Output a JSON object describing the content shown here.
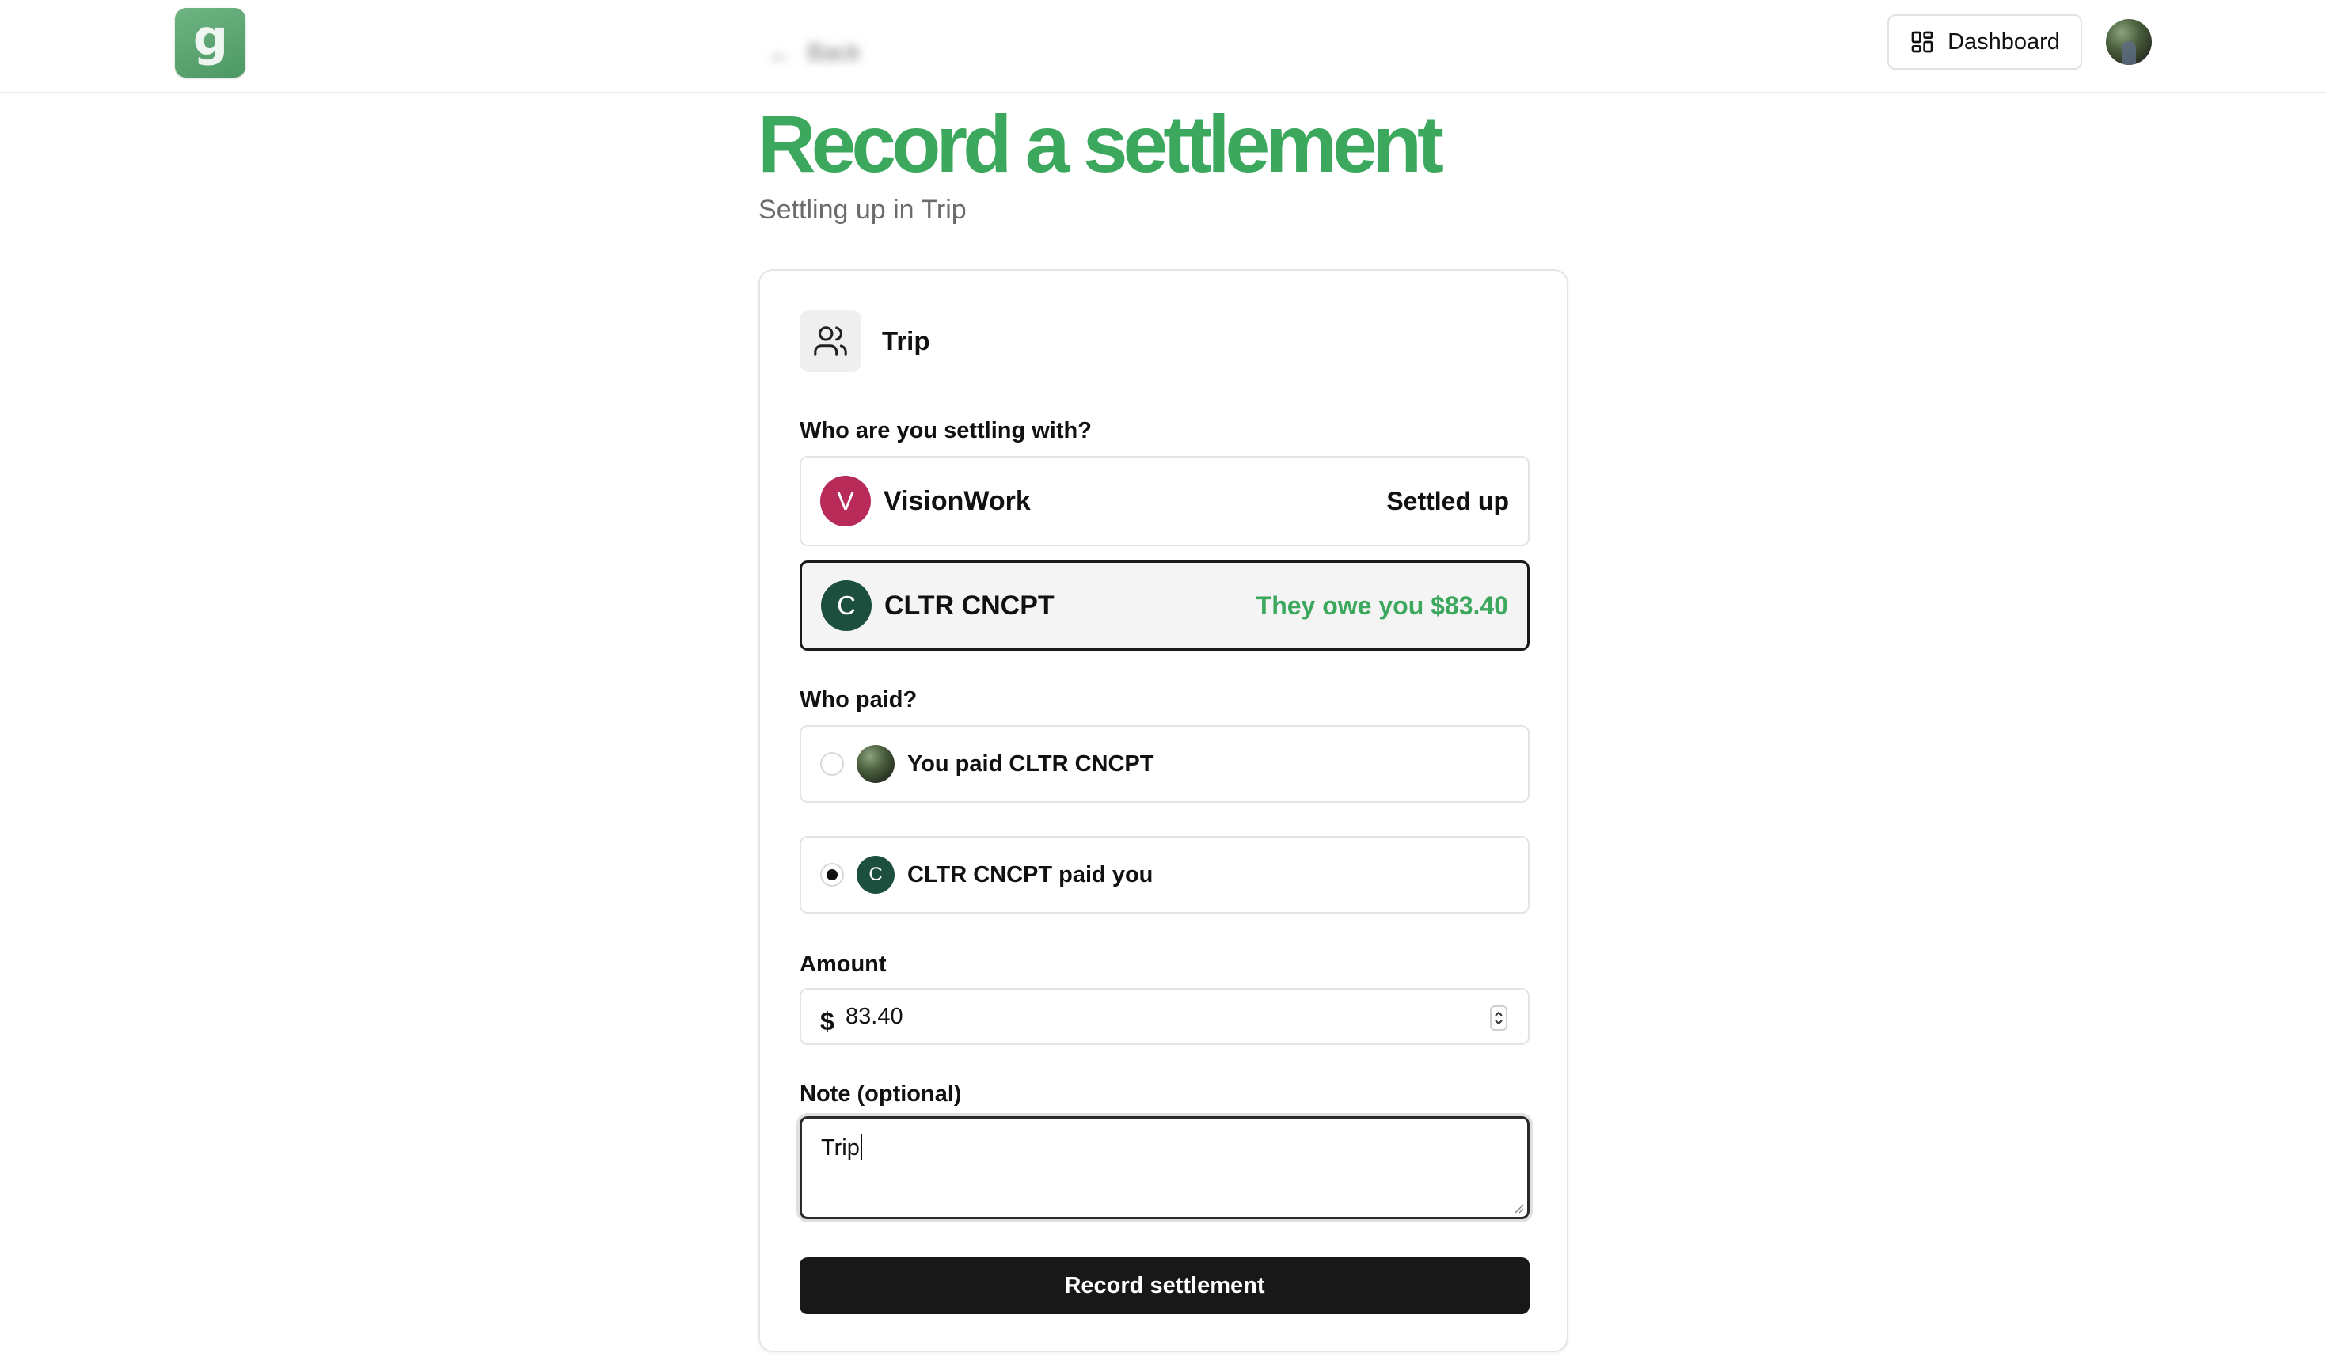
{
  "header": {
    "logo_letter": "g",
    "back_label": "Back",
    "dashboard_label": "Dashboard",
    "brand_color": "#3ba85d"
  },
  "page": {
    "title": "Record a settlement",
    "subtitle": "Settling up in Trip"
  },
  "group": {
    "name": "Trip",
    "icon": "users-icon"
  },
  "settle_with": {
    "label": "Who are you settling with?",
    "people": [
      {
        "initial": "V",
        "name": "VisionWork",
        "status": "Settled up",
        "avatar_color": "#b82a57",
        "status_color": "#111111",
        "selected": false
      },
      {
        "initial": "C",
        "name": "CLTR CNCPT",
        "status": "They owe you $83.40",
        "avatar_color": "#1d4f3f",
        "status_color": "#3ba85d",
        "selected": true
      }
    ]
  },
  "who_paid": {
    "label": "Who paid?",
    "options": [
      {
        "label": "You paid CLTR CNCPT",
        "selected": false
      },
      {
        "initial": "C",
        "label": "CLTR CNCPT paid you",
        "selected": true
      }
    ]
  },
  "amount": {
    "label": "Amount",
    "currency": "$",
    "value": "83.40"
  },
  "note": {
    "label": "Note (optional)",
    "value": "Trip"
  },
  "submit_label": "Record settlement"
}
